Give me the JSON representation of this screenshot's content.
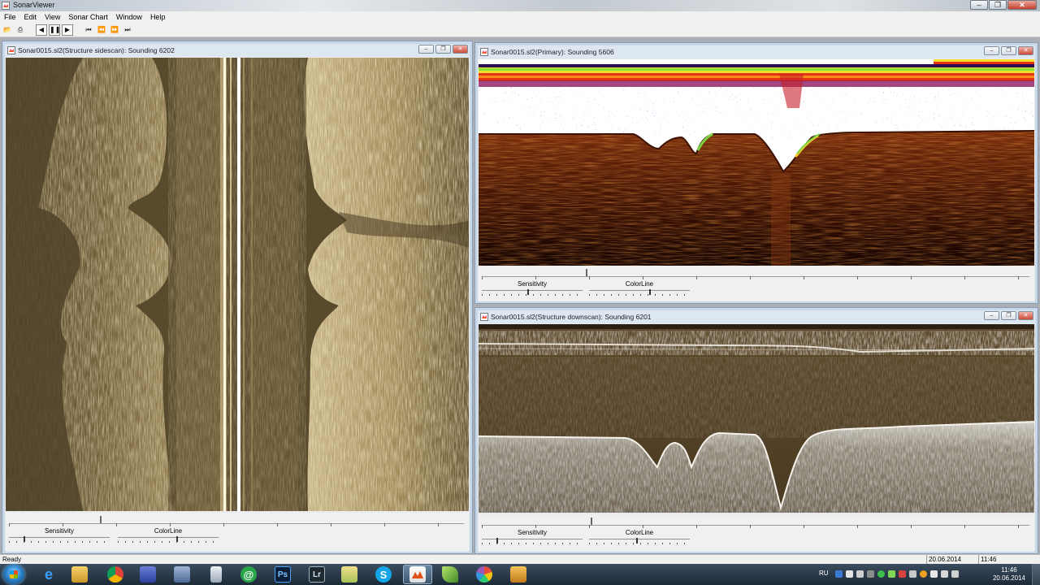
{
  "app": {
    "title": "SonarViewer"
  },
  "menu": [
    "File",
    "Edit",
    "View",
    "Sonar Chart",
    "Window",
    "Help"
  ],
  "toolbar": {
    "buttons": [
      "open-icon",
      "print-icon",
      "step-back-icon",
      "pause-icon",
      "play-icon",
      "skip-start-icon",
      "rewind-icon",
      "fast-forward-icon",
      "skip-end-icon"
    ]
  },
  "windows": {
    "sidescan": {
      "title": "Sonar0015.sl2(Structure sidescan): Sounding 6202",
      "sensitivity_label": "Sensitivity",
      "colorline_label": "ColorLine"
    },
    "primary": {
      "title": "Sonar0015.sl2(Primary): Sounding 5606",
      "sensitivity_label": "Sensitivity",
      "colorline_label": "ColorLine"
    },
    "downscan": {
      "title": "Sonar0015.sl2(Structure downscan): Sounding 6201",
      "sensitivity_label": "Sensitivity",
      "colorline_label": "ColorLine"
    }
  },
  "status": {
    "text": "Ready",
    "date": "20.06.2014",
    "time": "11:46"
  },
  "taskbar": {
    "apps": [
      "internet-explorer-icon",
      "file-explorer-icon",
      "chrome-icon",
      "save-disk-icon",
      "network-tool-icon",
      "calculator-icon",
      "mail-agent-icon",
      "photoshop-icon",
      "lightroom-icon",
      "folder-app-icon",
      "skype-icon",
      "sonarviewer-icon",
      "leaf-app-icon",
      "photo-viewer-icon",
      "tools-icon"
    ],
    "photoshop_label": "Ps",
    "lightroom_label": "Lr",
    "skype_label": "S"
  },
  "tray": {
    "language": "RU",
    "time": "11:46",
    "date": "20.06.2014"
  },
  "colors": {
    "sidescan_bg": "#584a2d",
    "primary_bg": "#3a1206",
    "downscan_bg": "#4a3a22",
    "accent": "#c9d8e8"
  }
}
